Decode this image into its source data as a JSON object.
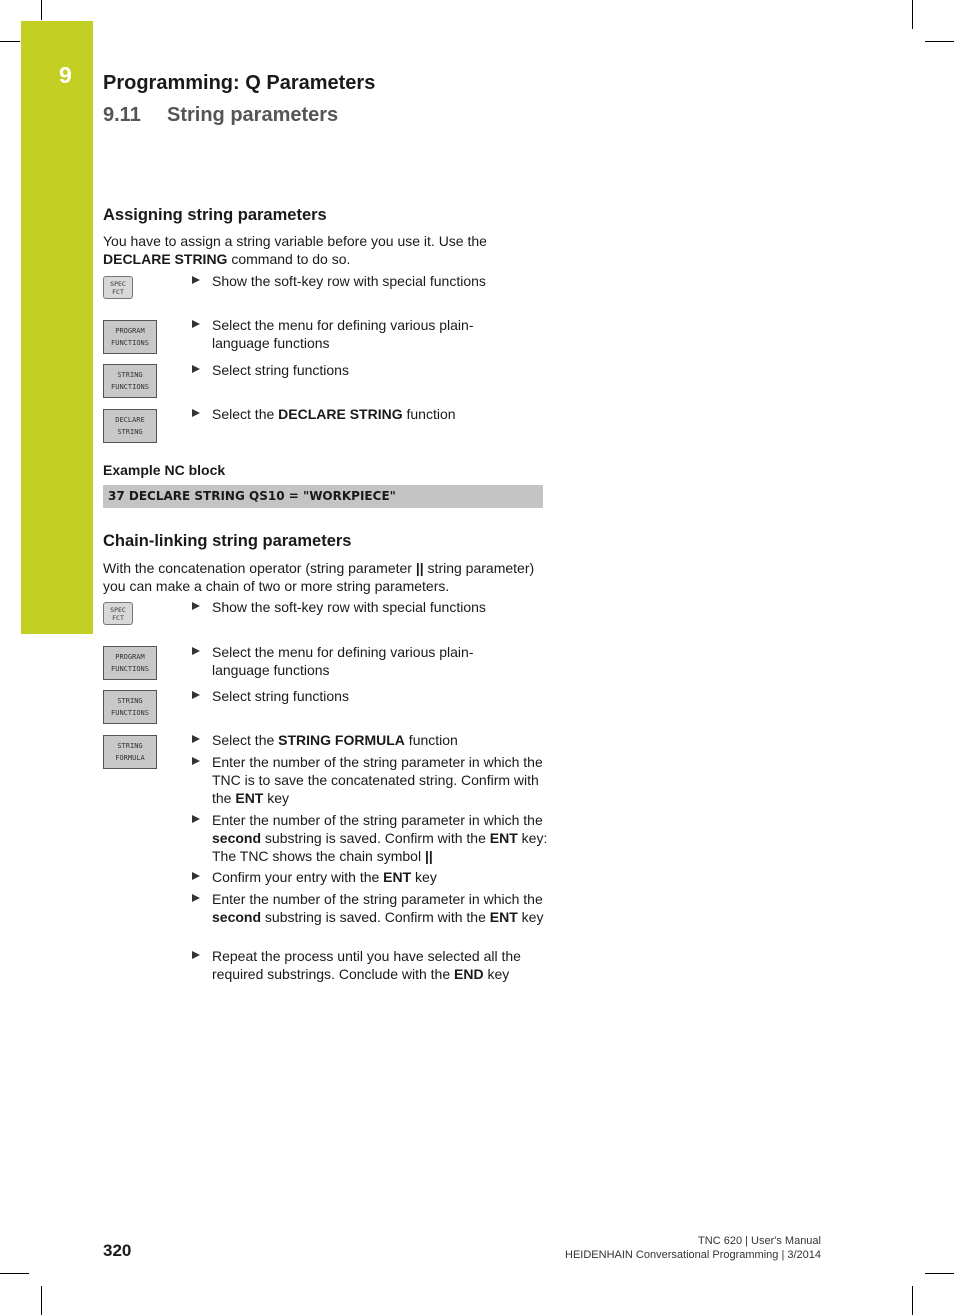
{
  "header": {
    "chapter_number": "9",
    "chapter_title": "Programming: Q Parameters",
    "section_number": "9.11",
    "section_title": "String parameters"
  },
  "assigning": {
    "heading": "Assigning string parameters",
    "intro_part1": "You have to assign a string variable before you use it. Use the ",
    "intro_bold": "DECLARE STRING",
    "intro_part2": " command to do so.",
    "steps": [
      {
        "key_line1": "SPEC",
        "key_line2": "FCT",
        "text": "Show the soft-key row with special functions"
      },
      {
        "key_line1": "PROGRAM",
        "key_line2": "FUNCTIONS",
        "text": "Select the menu for defining various plain-language functions"
      },
      {
        "key_line1": "STRING",
        "key_line2": "FUNCTIONS",
        "text": "Select string functions"
      },
      {
        "key_line1": "DECLARE",
        "key_line2": "STRING",
        "text_pre": "Select the ",
        "text_bold": "DECLARE STRING",
        "text_post": " function"
      }
    ],
    "example_heading": "Example NC block",
    "example_code": "37 DECLARE STRING QS10 = \"WORKPIECE\""
  },
  "chain": {
    "heading": "Chain-linking string parameters",
    "intro_part1": "With the concatenation operator (string parameter ",
    "intro_bold": "||",
    "intro_part2": " string parameter) you can make a chain of two or more string parameters.",
    "steps": [
      {
        "key_line1": "SPEC",
        "key_line2": "FCT",
        "text": "Show the soft-key row with special functions"
      },
      {
        "key_line1": "PROGRAM",
        "key_line2": "FUNCTIONS",
        "text": "Select the menu for defining various plain-language functions"
      },
      {
        "key_line1": "STRING",
        "key_line2": "FUNCTIONS",
        "text": "Select string functions"
      },
      {
        "key_line1": "STRING",
        "key_line2": "FORMULA",
        "text_pre": "Select the ",
        "text_bold": "STRING FORMULA",
        "text_post": " function"
      }
    ],
    "substeps": [
      {
        "a": "Enter the number of the string parameter in which the TNC is to save the concatenated string. Confirm with the ",
        "b": "ENT",
        "c": " key"
      },
      {
        "a": "Enter the number of the string parameter in which the ",
        "b": "second",
        "c": " substring is saved. Confirm with the ",
        "d": "ENT",
        "e": " key: The TNC shows the chain symbol ",
        "f": "||"
      },
      {
        "a": "Confirm your entry with the ",
        "b": "ENT",
        "c": " key"
      },
      {
        "a": "Enter the number of the string parameter in which the ",
        "b": "second",
        "c": " substring is saved. Confirm with the ",
        "d": "ENT",
        "e": " key"
      },
      {
        "a": "Repeat the process until you have selected all the required substrings. Conclude with the ",
        "b": "END",
        "c": " key"
      }
    ]
  },
  "footer": {
    "page_number": "320",
    "line1": "TNC 620 | User's Manual",
    "line2": "HEIDENHAIN Conversational Programming | 3/2014"
  }
}
